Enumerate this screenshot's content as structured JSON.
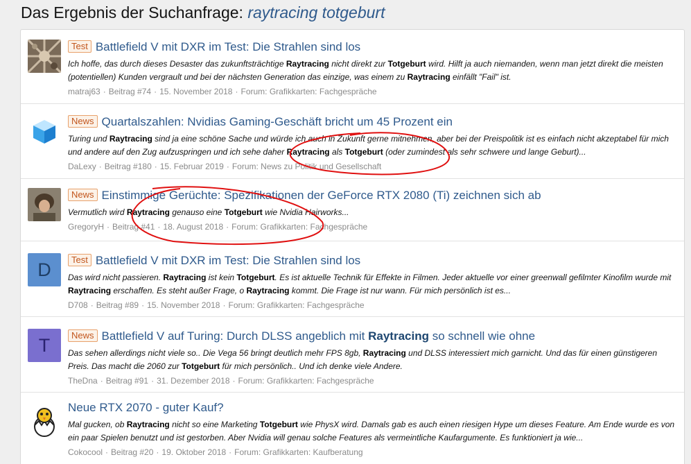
{
  "page": {
    "title_prefix": "Das Ergebnis der Suchanfrage: ",
    "query": "raytracing totgeburt"
  },
  "results": [
    {
      "prefix": "Test",
      "title_parts": [
        {
          "t": "Battlefield V mit DXR im Test: Die Strahlen sind los",
          "b": false
        }
      ],
      "snippet": [
        {
          "t": "Ich hoffe, das durch dieses Desaster das zukunftsträchtige ",
          "b": false
        },
        {
          "t": "Raytracing",
          "b": true
        },
        {
          "t": " nicht direkt zur ",
          "b": false
        },
        {
          "t": "Totgeburt",
          "b": true
        },
        {
          "t": " wird. Hilft ja auch niemanden, wenn man jetzt direkt die meisten (potentiellen) Kunden vergrault und bei der nächsten Generation das einzige, was einem zu ",
          "b": false
        },
        {
          "t": "Raytracing",
          "b": true
        },
        {
          "t": " einfällt \"Fail\" ist.",
          "b": false
        }
      ],
      "author": "matraj63",
      "post": "Beitrag #74",
      "date": "15. November 2018",
      "forum": "Forum: Grafikkarten: Fachgespräche",
      "avatar": {
        "type": "image",
        "icon": "photo-avatar"
      }
    },
    {
      "prefix": "News",
      "title_parts": [
        {
          "t": "Quartalszahlen: Nvidias Gaming-Geschäft bricht um 45 Prozent ein",
          "b": false
        }
      ],
      "snippet": [
        {
          "t": "Turing und ",
          "b": false
        },
        {
          "t": "Raytracing",
          "b": true
        },
        {
          "t": " sind ja eine schöne Sache und würde ich auch in Zukunft gerne mitnehmen, aber bei der Preispolitik ist es einfach nicht akzeptabel für mich und andere auf den Zug aufzuspringen und ich sehe daher ",
          "b": false
        },
        {
          "t": "Raytracing",
          "b": true
        },
        {
          "t": " als ",
          "b": false
        },
        {
          "t": "Totgeburt",
          "b": true
        },
        {
          "t": " (oder zumindest als sehr schwere und lange Geburt)...",
          "b": false
        }
      ],
      "author": "DaLexy",
      "post": "Beitrag #180",
      "date": "15. Februar 2019",
      "forum": "Forum: News zu Politik und Gesellschaft",
      "avatar": {
        "type": "image",
        "icon": "blue-cube-avatar"
      }
    },
    {
      "prefix": "News",
      "title_parts": [
        {
          "t": "Einstimmige Gerüchte: Spezifikationen der GeForce RTX 2080 (Ti) zeichnen sich ab",
          "b": false
        }
      ],
      "snippet": [
        {
          "t": "Vermutlich wird ",
          "b": false
        },
        {
          "t": "Raytracing",
          "b": true
        },
        {
          "t": " genauso eine ",
          "b": false
        },
        {
          "t": "Totgeburt",
          "b": true
        },
        {
          "t": " wie Nvidia Hairworks...",
          "b": false
        }
      ],
      "author": "GregoryH",
      "post": "Beitrag #41",
      "date": "18. August 2018",
      "forum": "Forum: Grafikkarten: Fachgespräche",
      "avatar": {
        "type": "image",
        "icon": "person-photo-avatar"
      }
    },
    {
      "prefix": "Test",
      "title_parts": [
        {
          "t": "Battlefield V mit DXR im Test: Die Strahlen sind los",
          "b": false
        }
      ],
      "snippet": [
        {
          "t": "Das wird nicht passieren. ",
          "b": false
        },
        {
          "t": "Raytracing",
          "b": true
        },
        {
          "t": " ist kein ",
          "b": false
        },
        {
          "t": "Totgeburt",
          "b": true
        },
        {
          "t": ". Es ist aktuelle Technik für Effekte in Filmen. Jeder aktuelle vor einer greenwall gefilmter Kinofilm wurde mit ",
          "b": false
        },
        {
          "t": "Raytracing",
          "b": true
        },
        {
          "t": " erschaffen. Es steht außer Frage, o ",
          "b": false
        },
        {
          "t": "Raytracing",
          "b": true
        },
        {
          "t": " kommt. Die Frage ist nur wann. Für mich persönlich ist es...",
          "b": false
        }
      ],
      "author": "D708",
      "post": "Beitrag #89",
      "date": "15. November 2018",
      "forum": "Forum: Grafikkarten: Fachgespräche",
      "avatar": {
        "type": "letter",
        "letter": "D",
        "bg": "#5b8fcf",
        "fg": "#1f3f66"
      }
    },
    {
      "prefix": "News",
      "title_parts": [
        {
          "t": "Battlefield V auf Turing: Durch DLSS angeblich mit ",
          "b": false
        },
        {
          "t": "Raytracing",
          "b": true
        },
        {
          "t": " so schnell wie ohne",
          "b": false
        }
      ],
      "snippet": [
        {
          "t": "Das sehen allerdings nicht viele so.. Die Vega 56 bringt deutlich mehr FPS 8gb, ",
          "b": false
        },
        {
          "t": "Raytracing",
          "b": true
        },
        {
          "t": " und DLSS interessiert mich garnicht. Und das für einen günstigeren Preis. Das macht die 2060 zur ",
          "b": false
        },
        {
          "t": "Totgeburt",
          "b": true
        },
        {
          "t": " für mich persönlich.. Und ich denke viele Andere.",
          "b": false
        }
      ],
      "author": "TheDna",
      "post": "Beitrag #91",
      "date": "31. Dezember 2018",
      "forum": "Forum: Grafikkarten: Fachgespräche",
      "avatar": {
        "type": "letter",
        "letter": "T",
        "bg": "#7a6fcf",
        "fg": "#2a2270"
      }
    },
    {
      "prefix": "",
      "title_parts": [
        {
          "t": "Neue RTX 2070 - guter Kauf?",
          "b": false
        }
      ],
      "snippet": [
        {
          "t": "Mal gucken, ob ",
          "b": false
        },
        {
          "t": "Raytracing",
          "b": true
        },
        {
          "t": " nicht so eine Marketing ",
          "b": false
        },
        {
          "t": "Totgeburt",
          "b": true
        },
        {
          "t": " wie PhysX wird. Damals gab es auch einen riesigen Hype um dieses Feature. Am Ende wurde es von ein paar Spielen benutzt und ist gestorben. Aber Nvidia will genau solche Features als vermeintliche Kaufargumente. Es funktioniert ja wie...",
          "b": false
        }
      ],
      "author": "Cokocool",
      "post": "Beitrag #20",
      "date": "19. Oktober 2018",
      "forum": "Forum: Grafikkarten: Kaufberatung",
      "avatar": {
        "type": "image",
        "icon": "chick-egg-avatar"
      }
    }
  ]
}
